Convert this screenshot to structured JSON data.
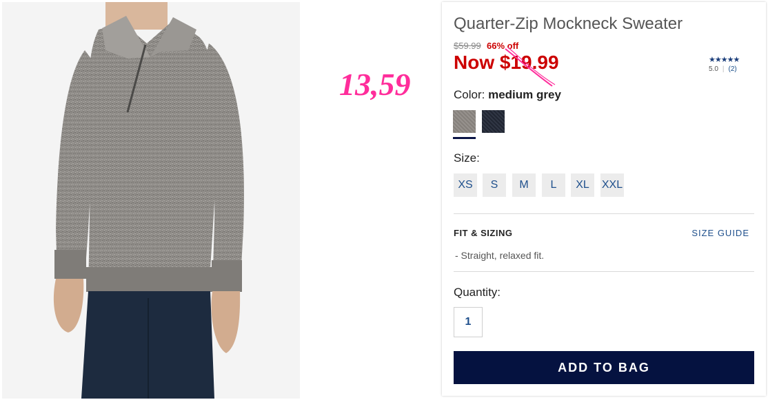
{
  "product": {
    "title": "Quarter-Zip Mockneck Sweater",
    "original_price": "$59.99",
    "discount": "66% off",
    "now_price": "Now $19.99"
  },
  "rating": {
    "stars": "★★★★★",
    "score": "5.0",
    "count": "(2)"
  },
  "overlay": {
    "handwritten_price": "13,59",
    "color": "#ff2d9b"
  },
  "color": {
    "label": "Color:",
    "selected": "medium grey",
    "swatches": [
      "medium grey",
      "navy"
    ]
  },
  "size": {
    "label": "Size:",
    "options": [
      "XS",
      "S",
      "M",
      "L",
      "XL",
      "XXL"
    ]
  },
  "fit": {
    "heading": "FIT & SIZING",
    "guide_link": "SIZE GUIDE",
    "text": "- Straight, relaxed fit."
  },
  "quantity": {
    "label": "Quantity:",
    "value": "1"
  },
  "cart": {
    "button_label": "ADD TO BAG"
  },
  "colors": {
    "sale_red": "#cc0000",
    "navy": "#051240",
    "link_blue": "#1e4f8c"
  }
}
